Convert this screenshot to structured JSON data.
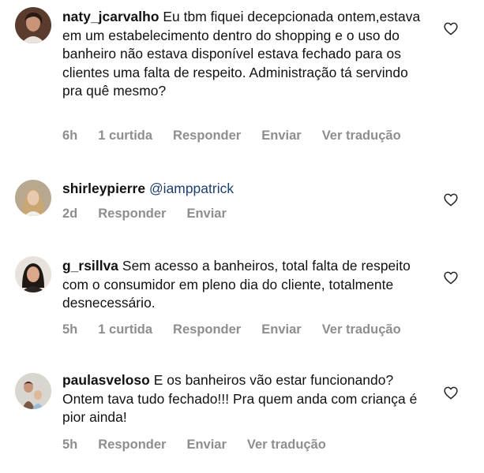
{
  "comments": [
    {
      "username": "naty_jcarvalho",
      "text": "Eu tbm fiquei decepcionada ontem,estava em um estabelecimento dentro do shopping e o uso do banheiro não estava disponível estava fechado para os clientes uma falta de respeito. Administração tá servindo pra quê mesmo?",
      "time": "6h",
      "likes": "1 curtida",
      "reply": "Responder",
      "send": "Enviar",
      "translate": "Ver tradução"
    },
    {
      "username": "shirleypierre",
      "text": "@iamppatrick",
      "time": "2d",
      "reply": "Responder",
      "send": "Enviar"
    },
    {
      "username": "g_rsillva",
      "text": "Sem acesso a banheiros, total falta de respeito com o consumidor em pleno dia do cliente, totalmente desnecessário.",
      "time": "5h",
      "likes": "1 curtida",
      "reply": "Responder",
      "send": "Enviar",
      "translate": "Ver tradução"
    },
    {
      "username": "paulasveloso",
      "text": "E os banheiros vão estar funcionando? Ontem tava tudo fechado!!! Pra quem anda com criança é pior ainda!",
      "time": "5h",
      "reply": "Responder",
      "send": "Enviar",
      "translate": "Ver tradução"
    }
  ],
  "icons": {
    "like": "heart-outline-icon",
    "avatar": "profile-photo"
  },
  "colors": {
    "text": "#111111",
    "meta": "#8e8e8e",
    "mention": "#1d3f6e"
  }
}
